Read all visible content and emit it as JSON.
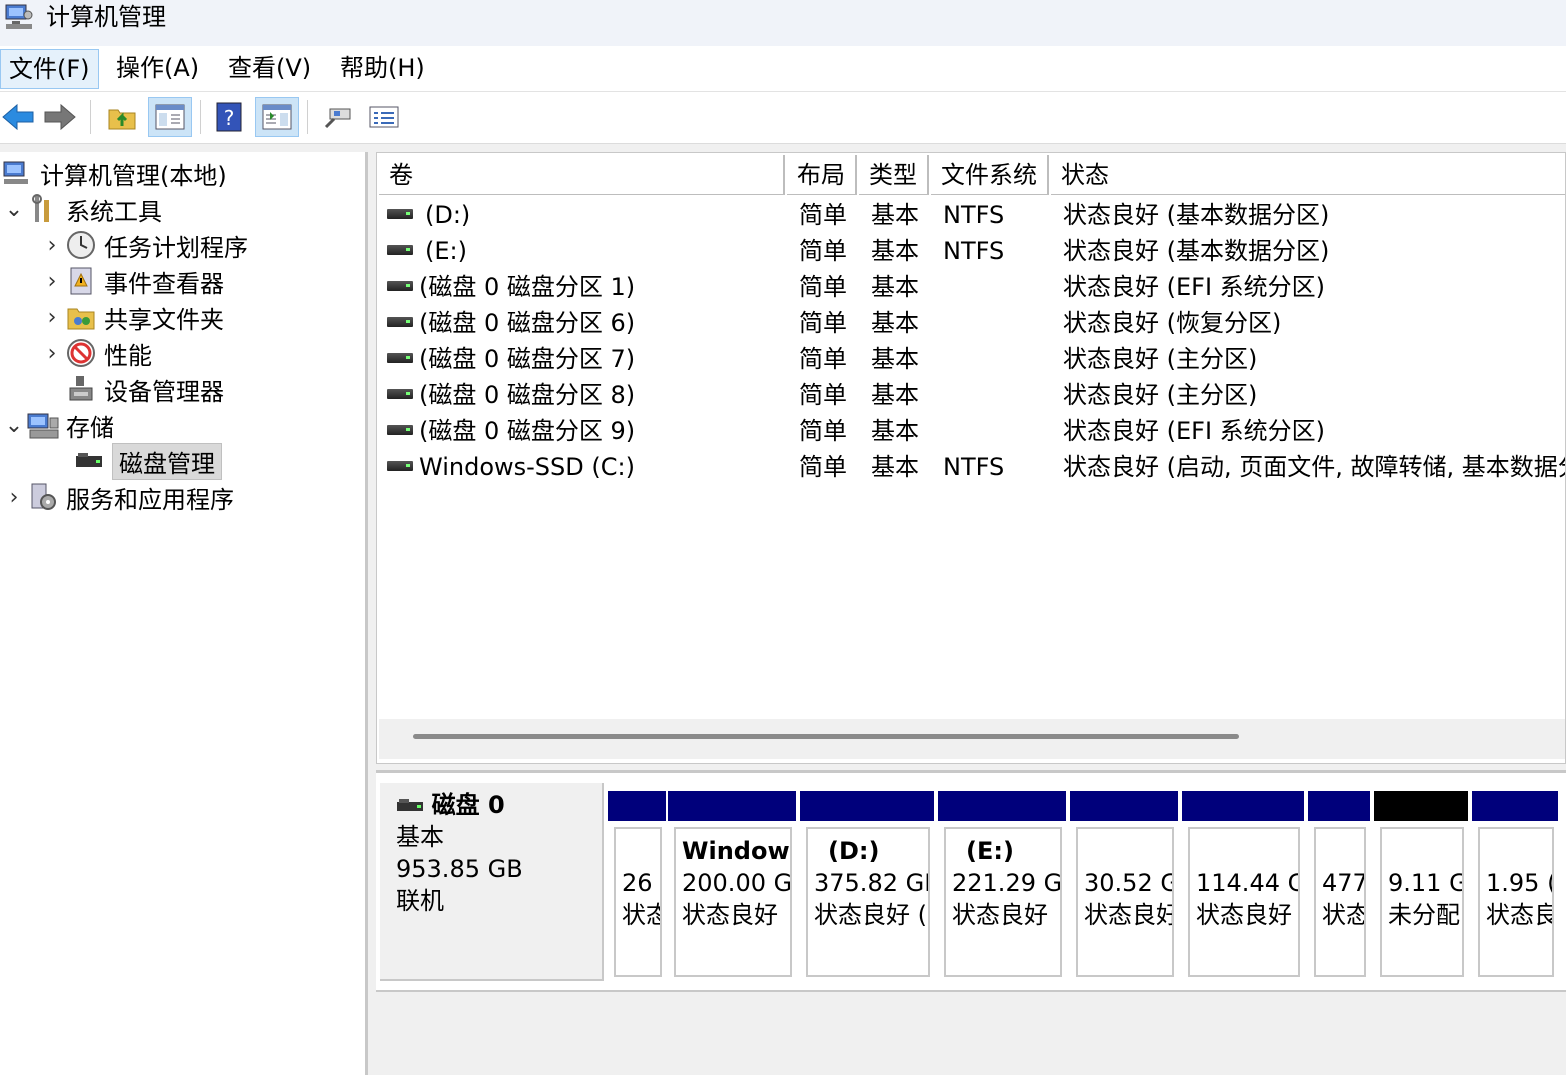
{
  "window": {
    "title": "计算机管理"
  },
  "menu": [
    "文件(F)",
    "操作(A)",
    "查看(V)",
    "帮助(H)"
  ],
  "toolbar": [
    "back-icon",
    "forward-icon",
    "up-folder-icon",
    "show-hide-tree-icon",
    "help-icon",
    "show-action-pane-icon",
    "connect-icon",
    "properties-icon"
  ],
  "tree": {
    "root": "计算机管理(本地)",
    "system_tools": "系统工具",
    "task_scheduler": "任务计划程序",
    "event_viewer": "事件查看器",
    "shared_folders": "共享文件夹",
    "performance": "性能",
    "device_manager": "设备管理器",
    "storage": "存储",
    "disk_management": "磁盘管理",
    "services_apps": "服务和应用程序"
  },
  "volume_columns": [
    "卷",
    "布局",
    "类型",
    "文件系统",
    "状态"
  ],
  "volumes": [
    {
      "name": "(D:)",
      "layout": "简单",
      "type": "基本",
      "fs": "NTFS",
      "status": "状态良好 (基本数据分区)"
    },
    {
      "name": "(E:)",
      "layout": "简单",
      "type": "基本",
      "fs": "NTFS",
      "status": "状态良好 (基本数据分区)"
    },
    {
      "name": "(磁盘 0 磁盘分区 1)",
      "layout": "简单",
      "type": "基本",
      "fs": "",
      "status": "状态良好 (EFI 系统分区)"
    },
    {
      "name": "(磁盘 0 磁盘分区 6)",
      "layout": "简单",
      "type": "基本",
      "fs": "",
      "status": "状态良好 (恢复分区)"
    },
    {
      "name": "(磁盘 0 磁盘分区 7)",
      "layout": "简单",
      "type": "基本",
      "fs": "",
      "status": "状态良好 (主分区)"
    },
    {
      "name": "(磁盘 0 磁盘分区 8)",
      "layout": "简单",
      "type": "基本",
      "fs": "",
      "status": "状态良好 (主分区)"
    },
    {
      "name": "(磁盘 0 磁盘分区 9)",
      "layout": "简单",
      "type": "基本",
      "fs": "",
      "status": "状态良好 (EFI 系统分区)"
    },
    {
      "name": "Windows-SSD (C:)",
      "layout": "简单",
      "type": "基本",
      "fs": "NTFS",
      "status": "状态良好 (启动, 页面文件, 故障转储, 基本数据分"
    }
  ],
  "disk": {
    "name": "磁盘 0",
    "type": "基本",
    "size": "953.85 GB",
    "state": "联机"
  },
  "partitions": [
    {
      "name": "",
      "size": "26",
      "status": "状态",
      "unallocated": false
    },
    {
      "name": "Window",
      "size": "200.00 G",
      "status": "状态良好",
      "unallocated": false
    },
    {
      "name": "(D:)",
      "size": "375.82 GI",
      "status": "状态良好 (",
      "unallocated": false
    },
    {
      "name": "(E:)",
      "size": "221.29 G",
      "status": "状态良好",
      "unallocated": false
    },
    {
      "name": "",
      "size": "30.52 G",
      "status": "状态良好",
      "unallocated": false
    },
    {
      "name": "",
      "size": "114.44 G",
      "status": "状态良好",
      "unallocated": false
    },
    {
      "name": "",
      "size": "477",
      "status": "状态",
      "unallocated": false
    },
    {
      "name": "",
      "size": "9.11 G",
      "status": "未分配",
      "unallocated": true
    },
    {
      "name": "",
      "size": "1.95 (",
      "status": "状态良",
      "unallocated": false
    }
  ],
  "colors": {
    "partition_bar": "#00007b",
    "unallocated_bar": "#000000",
    "selection": "#d9d9d9"
  }
}
